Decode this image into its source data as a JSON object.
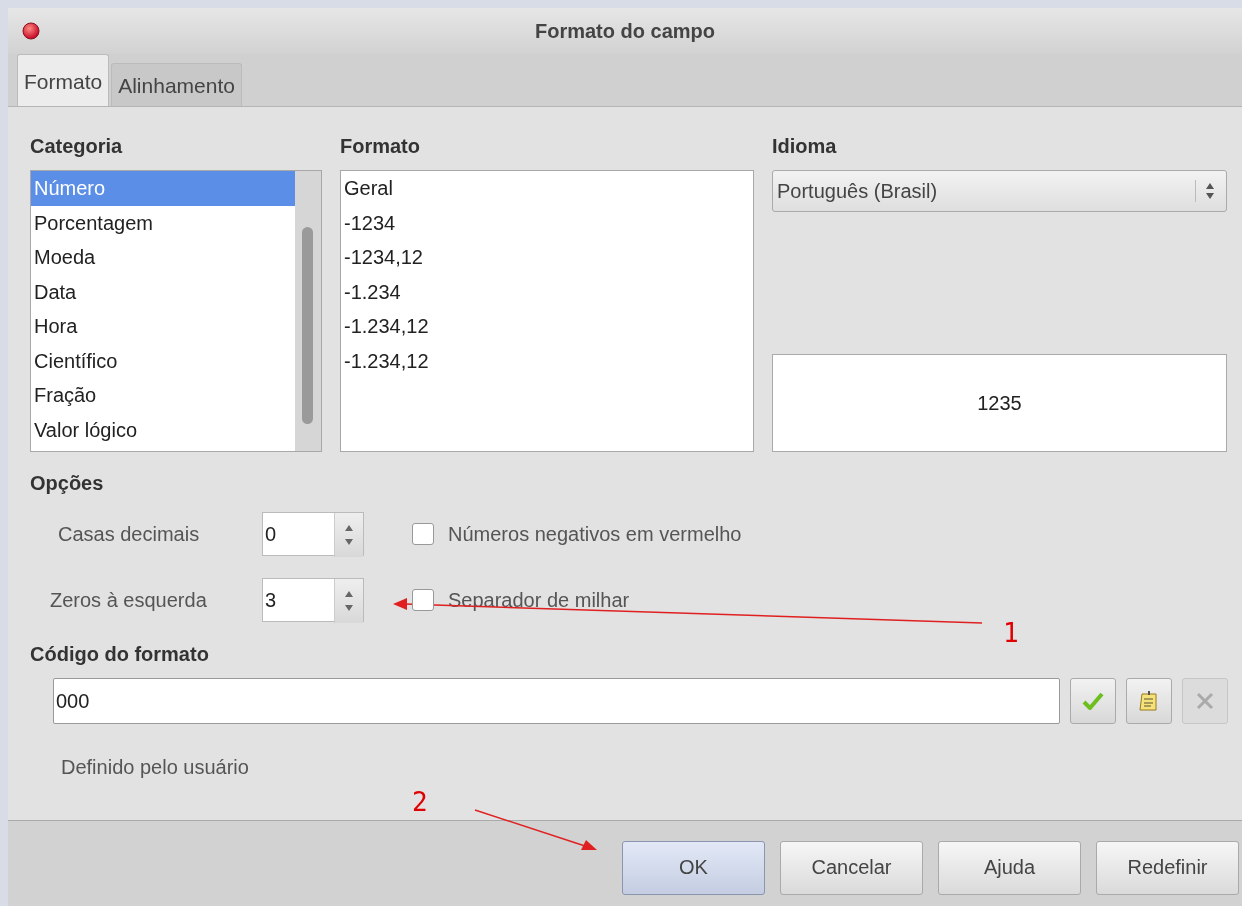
{
  "window": {
    "title": "Formato do campo"
  },
  "tabs": [
    {
      "label": "Formato",
      "selected": true
    },
    {
      "label": "Alinhamento",
      "selected": false
    }
  ],
  "category": {
    "label": "Categoria",
    "items": [
      {
        "label": "Número",
        "selected": true
      },
      {
        "label": "Porcentagem",
        "selected": false
      },
      {
        "label": "Moeda",
        "selected": false
      },
      {
        "label": "Data",
        "selected": false
      },
      {
        "label": "Hora",
        "selected": false
      },
      {
        "label": "Científico",
        "selected": false
      },
      {
        "label": "Fração",
        "selected": false
      },
      {
        "label": "Valor lógico",
        "selected": false
      }
    ]
  },
  "format": {
    "label": "Formato",
    "items": [
      {
        "label": "Geral",
        "selected": false
      },
      {
        "label": "-1234",
        "selected": false
      },
      {
        "label": "-1234,12",
        "selected": false
      },
      {
        "label": "-1.234",
        "selected": false
      },
      {
        "label": "-1.234,12",
        "selected": false
      },
      {
        "label": "-1.234,12",
        "selected": false
      }
    ]
  },
  "language": {
    "label": "Idioma",
    "value": "Português (Brasil)"
  },
  "preview": "1235",
  "options": {
    "title": "Opções",
    "rows": [
      {
        "label": "Casas decimais",
        "value": "0",
        "checkbox": {
          "label": "Números negativos em vermelho",
          "checked": false
        }
      },
      {
        "label": "Zeros à esquerda",
        "value": "3",
        "checkbox": {
          "label": "Separador de milhar",
          "checked": false
        }
      }
    ]
  },
  "format_code": {
    "label": "Código do formato",
    "value": "000",
    "tools": [
      {
        "kind": "accept",
        "disabled": false
      },
      {
        "kind": "comment",
        "disabled": false
      },
      {
        "kind": "delete",
        "disabled": true
      }
    ]
  },
  "description": "Definido pelo usuário",
  "buttons": [
    {
      "label": "OK",
      "default": true
    },
    {
      "label": "Cancelar",
      "default": false
    },
    {
      "label": "Ajuda",
      "default": false
    },
    {
      "label": "Redefinir",
      "default": false
    }
  ],
  "annotations": [
    {
      "label": "1"
    },
    {
      "label": "2"
    }
  ]
}
